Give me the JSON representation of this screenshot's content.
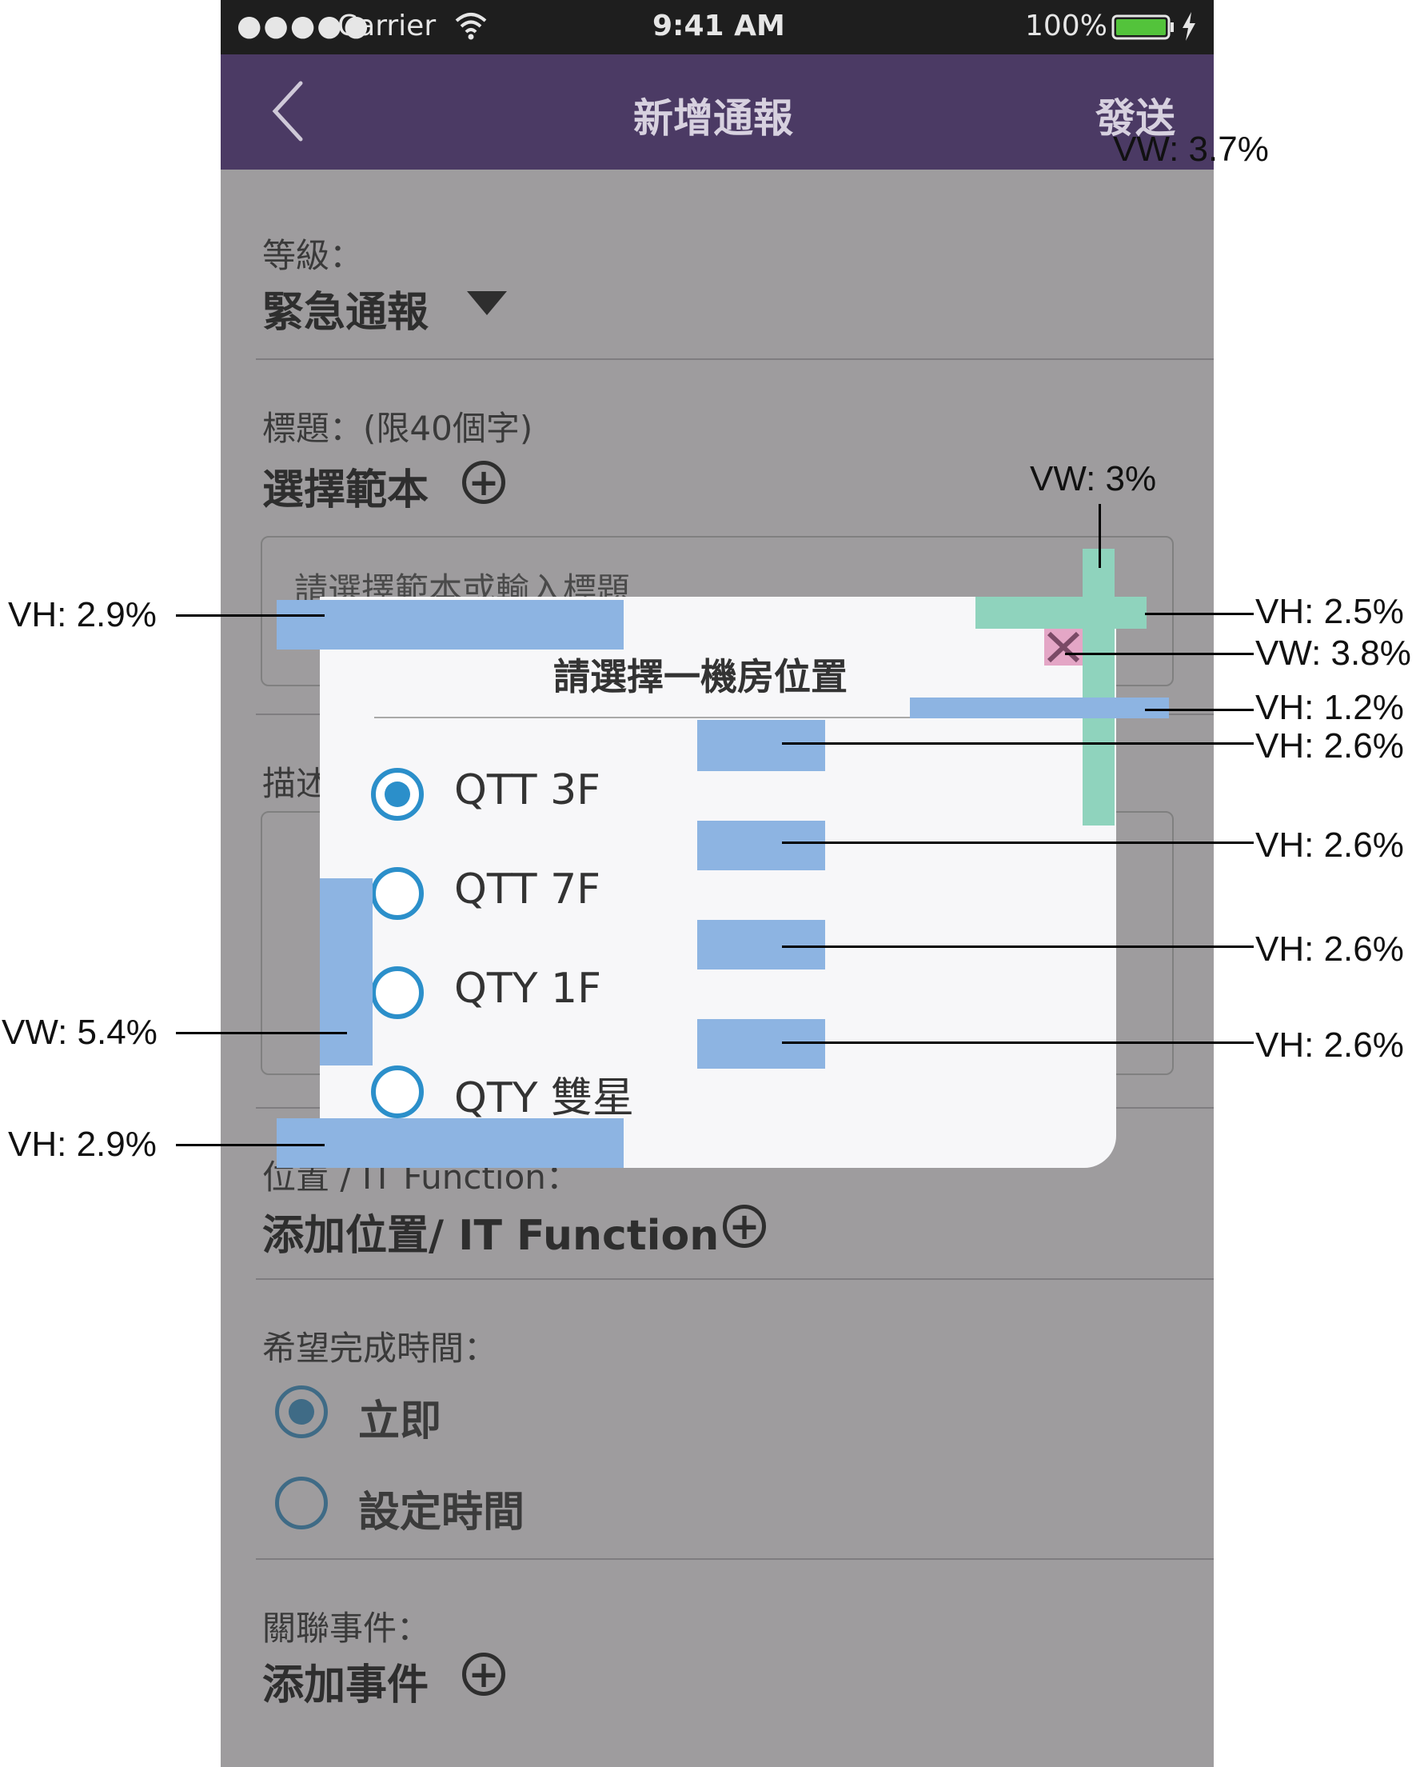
{
  "status_bar": {
    "signal": "●●●●●",
    "carrier": "Carrier",
    "time": "9:41 AM",
    "battery_percent": "100%",
    "icons": [
      "wifi-icon",
      "battery-icon",
      "charging-bolt-icon"
    ]
  },
  "nav": {
    "title": "新增通報",
    "send": "發送",
    "back_icon": "chevron-left-icon"
  },
  "form": {
    "level_label": "等級：",
    "level_value": "緊急通報",
    "title_label": "標題：(限40個字)",
    "template_label": "選擇範本",
    "title_placeholder": "請選擇範本或輸入標題",
    "desc_label": "描述",
    "location_label": "位置 / IT Function：",
    "location_add": "添加位置/ IT Function",
    "time_label": "希望完成時間：",
    "time_options": [
      {
        "label": "立即",
        "selected": true
      },
      {
        "label": "設定時間",
        "selected": false
      }
    ],
    "event_label": "關聯事件：",
    "event_add": "添加事件",
    "plus_icon": "plus-circle-icon"
  },
  "modal": {
    "title": "請選擇一機房位置",
    "close_icon": "close-icon",
    "options": [
      {
        "label": "QTT 3F",
        "selected": true
      },
      {
        "label": "QTT 7F",
        "selected": false
      },
      {
        "label": "QTY 1F",
        "selected": false
      },
      {
        "label": "QTY 雙星",
        "selected": false
      }
    ]
  },
  "annotations": {
    "vw_send": "VW: 3.7%",
    "vw_close_col": "VW: 3%",
    "vh_close_row": "VH: 2.5%",
    "vw_close": "VW: 3.8%",
    "vh_title_gap": "VH: 1.2%",
    "vh_option_1": "VH: 2.6%",
    "vh_option_2": "VH: 2.6%",
    "vh_option_3": "VH: 2.6%",
    "vh_option_4": "VH: 2.6%",
    "vh_top_pad": "VH: 2.9%",
    "vw_left_pad": "VW: 5.4%",
    "vh_bottom_pad": "VH: 2.9%"
  },
  "colors": {
    "nav_bg": "#4b3a64",
    "dim_bg": "#9e9c9e",
    "modal_bg": "#f7f7f9",
    "radio_accent": "#2b8fca",
    "annotation_blue": "#8db4e2",
    "annotation_green": "#8fd3bd",
    "annotation_pink": "#e4a6c6"
  }
}
